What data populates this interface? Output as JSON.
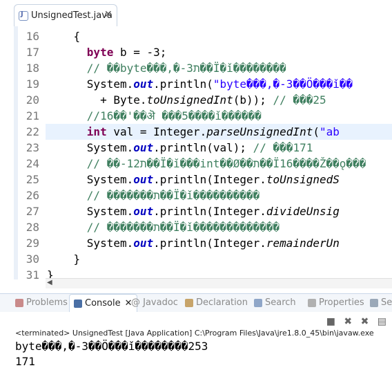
{
  "editor": {
    "tab": {
      "label": "UnsignedTest.java",
      "close": "✕"
    },
    "lines": [
      {
        "num": "16",
        "segments": [
          {
            "t": "    {",
            "c": ""
          }
        ]
      },
      {
        "num": "17",
        "segments": [
          {
            "t": "      ",
            "c": ""
          },
          {
            "t": "byte",
            "c": "kw"
          },
          {
            "t": " b = -3;",
            "c": ""
          }
        ]
      },
      {
        "num": "18",
        "segments": [
          {
            "t": "      // ��byte���,�-ת3��Ï�ǐ��������",
            "c": "cmt"
          }
        ]
      },
      {
        "num": "19",
        "segments": [
          {
            "t": "      System.",
            "c": ""
          },
          {
            "t": "out",
            "c": "fld"
          },
          {
            "t": ".println(",
            "c": ""
          },
          {
            "t": "\"byte���,�-3��Ö���ǐ��",
            "c": "str"
          }
        ]
      },
      {
        "num": "20",
        "segments": [
          {
            "t": "        + Byte.",
            "c": ""
          },
          {
            "t": "toUnsignedInt",
            "c": "it"
          },
          {
            "t": "(b)); ",
            "c": ""
          },
          {
            "t": "// ���25",
            "c": "cmt"
          }
        ]
      },
      {
        "num": "21",
        "segments": [
          {
            "t": "      //16��'��ऄ ���5����ǐ������",
            "c": "cmt"
          }
        ]
      },
      {
        "num": "22",
        "segments": [
          {
            "t": "      ",
            "c": ""
          },
          {
            "t": "int",
            "c": "kw"
          },
          {
            "t": " val = Integer.",
            "c": ""
          },
          {
            "t": "parseUnsignedInt",
            "c": "it"
          },
          {
            "t": "(",
            "c": ""
          },
          {
            "t": "\"ab",
            "c": "str"
          }
        ]
      },
      {
        "num": "23",
        "segments": [
          {
            "t": "      System.",
            "c": ""
          },
          {
            "t": "out",
            "c": "fld"
          },
          {
            "t": ".println(val); ",
            "c": ""
          },
          {
            "t": "// ���171",
            "c": "cmt"
          }
        ]
      },
      {
        "num": "24",
        "segments": [
          {
            "t": "      // ��-ת12��Ï�ǐ���int��Ø��ת��Ï16����Ž��ǫ���",
            "c": "cmt"
          }
        ]
      },
      {
        "num": "25",
        "segments": [
          {
            "t": "      System.",
            "c": ""
          },
          {
            "t": "out",
            "c": "fld"
          },
          {
            "t": ".println(Integer.",
            "c": ""
          },
          {
            "t": "toUnsignedS",
            "c": "it"
          }
        ]
      },
      {
        "num": "26",
        "segments": [
          {
            "t": "      // �������ת��Ï�ǐ����������",
            "c": "cmt"
          }
        ]
      },
      {
        "num": "27",
        "segments": [
          {
            "t": "      System.",
            "c": ""
          },
          {
            "t": "out",
            "c": "fld"
          },
          {
            "t": ".println(Integer.",
            "c": ""
          },
          {
            "t": "divideUnsig",
            "c": "it"
          }
        ]
      },
      {
        "num": "28",
        "segments": [
          {
            "t": "      // �������ת��Ï�ǐ�������������",
            "c": "cmt"
          }
        ]
      },
      {
        "num": "29",
        "segments": [
          {
            "t": "      System.",
            "c": ""
          },
          {
            "t": "out",
            "c": "fld"
          },
          {
            "t": ".println(Integer.",
            "c": ""
          },
          {
            "t": "remainderUn",
            "c": "it"
          }
        ]
      },
      {
        "num": "30",
        "segments": [
          {
            "t": "    }",
            "c": ""
          }
        ]
      },
      {
        "num": "31",
        "segments": [
          {
            "t": "}",
            "c": ""
          }
        ]
      }
    ]
  },
  "console": {
    "tabs": [
      {
        "label": "Problems",
        "icon": "problems-icon",
        "color": "#c98a8a"
      },
      {
        "label": "Console",
        "icon": "console-icon",
        "color": "#4a6fa5",
        "close": "✕"
      },
      {
        "label": "@ Javadoc",
        "icon": "",
        "color": ""
      },
      {
        "label": "Declaration",
        "icon": "declaration-icon",
        "color": "#c7a46a"
      },
      {
        "label": "Search",
        "icon": "search-icon",
        "color": "#8fa6c8"
      },
      {
        "label": "Properties",
        "icon": "properties-icon",
        "color": "#b0b0b0"
      },
      {
        "label": "Se",
        "icon": "servers-icon",
        "color": "#9aa8b8"
      }
    ],
    "toolbar": {
      "stop": "■",
      "remove": "✖",
      "remove_all": "✖",
      "pin": "▤"
    },
    "terminated": "<terminated> UnsignedTest [Java Application] C:\\Program Files\\Java\\jre1.8.0_45\\bin\\javaw.exe",
    "output": [
      "byte���,�-3��Ö���ǐ��������253",
      "171"
    ]
  },
  "colors": {
    "keyword": "#7f0055",
    "field": "#0000c0",
    "string": "#2a00ff",
    "comment": "#3f7f5f",
    "current_line": "#e8f2fe"
  }
}
